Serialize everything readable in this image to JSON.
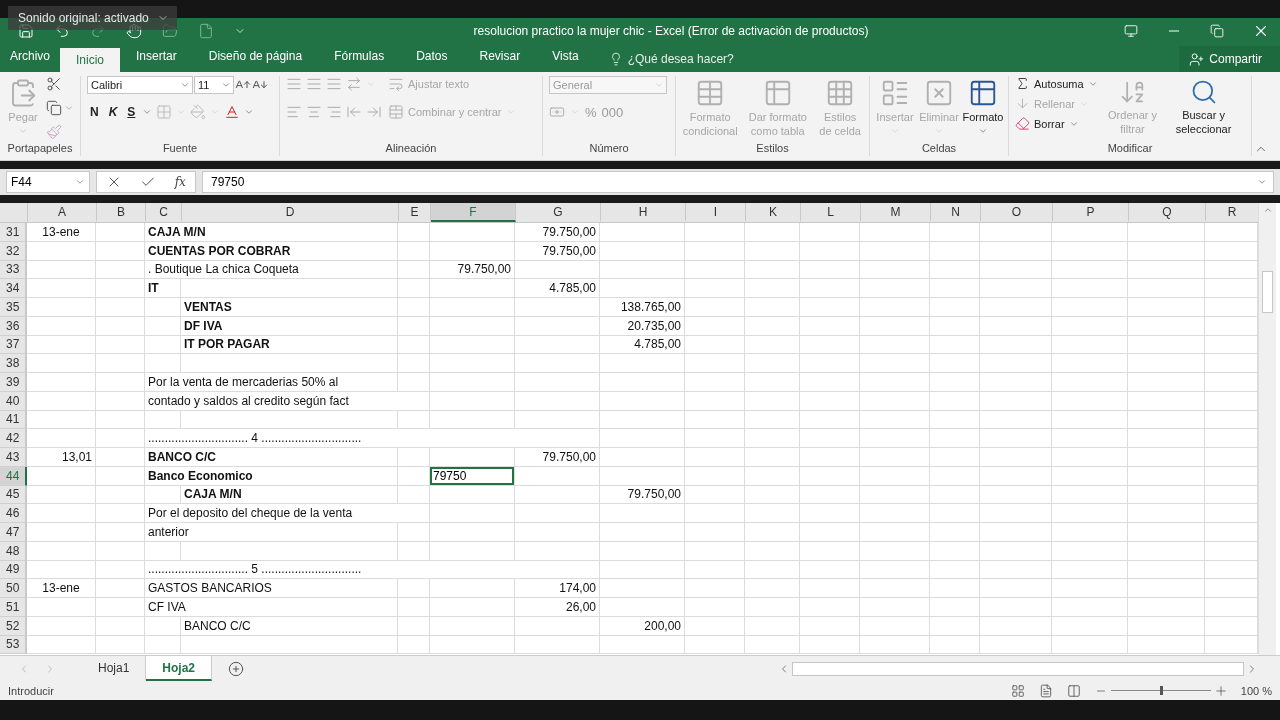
{
  "overlay": {
    "label": "Sonido original: activado"
  },
  "window": {
    "title": "resolucion practico la mujer chic - Excel (Error de activación de productos)"
  },
  "ribbon_tabs": [
    {
      "label": "Archivo",
      "selected": false
    },
    {
      "label": "Inicio",
      "selected": true
    },
    {
      "label": "Insertar",
      "selected": false
    },
    {
      "label": "Diseño de página",
      "selected": false
    },
    {
      "label": "Fórmulas",
      "selected": false
    },
    {
      "label": "Datos",
      "selected": false
    },
    {
      "label": "Revisar",
      "selected": false
    },
    {
      "label": "Vista",
      "selected": false
    }
  ],
  "tell_me": {
    "placeholder": "¿Qué desea hacer?"
  },
  "share_button": {
    "label": "Compartir"
  },
  "clipboard": {
    "title": "Portapapeles",
    "paste": {
      "label": "Pegar",
      "disabled": true
    }
  },
  "font": {
    "title": "Fuente",
    "name": "Calibri",
    "size": "11",
    "bold": "N",
    "italic": "K",
    "underline": "S"
  },
  "alignment": {
    "title": "Alineación",
    "wrap": {
      "label": "Ajustar texto",
      "disabled": true
    },
    "merge": {
      "label": "Combinar y centrar",
      "disabled": true
    }
  },
  "number": {
    "title": "Número",
    "format": {
      "value": "General",
      "disabled": true
    },
    "percent": "%",
    "thousands": "000"
  },
  "styles": {
    "title": "Estilos",
    "items": [
      {
        "label": "Formato condicional",
        "disabled": true
      },
      {
        "label": "Dar formato como tabla",
        "disabled": true
      },
      {
        "label": "Estilos de celda",
        "disabled": true
      }
    ]
  },
  "cells": {
    "title": "Celdas",
    "items": [
      {
        "label": "Insertar",
        "disabled": true
      },
      {
        "label": "Eliminar",
        "disabled": true
      },
      {
        "label": "Formato",
        "disabled": false
      }
    ]
  },
  "editing": {
    "title": "Modificar",
    "items": [
      {
        "label": "Autosuma",
        "disabled": false
      },
      {
        "label": "Rellenar",
        "disabled": true
      },
      {
        "label": "Borrar",
        "disabled": false
      }
    ],
    "sort": {
      "label": "Ordenar y filtrar",
      "disabled": true
    },
    "find": {
      "label": "Buscar y seleccionar",
      "disabled": false
    }
  },
  "formula_bar": {
    "name_box": "F44",
    "function_label": "fx",
    "value": "79750"
  },
  "sheet": {
    "columns": [
      {
        "label": "A",
        "selected": false
      },
      {
        "label": "B",
        "selected": false
      },
      {
        "label": "C",
        "selected": false
      },
      {
        "label": "D",
        "selected": false
      },
      {
        "label": "E",
        "selected": false
      },
      {
        "label": "F",
        "selected": true
      },
      {
        "label": "G",
        "selected": false
      },
      {
        "label": "H",
        "selected": false
      },
      {
        "label": "I",
        "selected": false
      },
      {
        "label": "K",
        "selected": false
      },
      {
        "label": "L",
        "selected": false
      },
      {
        "label": "M",
        "selected": false
      },
      {
        "label": "N",
        "selected": false
      },
      {
        "label": "O",
        "selected": false
      },
      {
        "label": "P",
        "selected": false
      },
      {
        "label": "Q",
        "selected": false
      },
      {
        "label": "R",
        "selected": false
      }
    ],
    "rows": [
      {
        "number": "31",
        "selected": false,
        "cells": {
          "a": {
            "text": "13-ene",
            "kind": "date"
          },
          "c": {
            "text": "CAJA M/N",
            "kind": "account"
          },
          "g": {
            "text": "79.750,00",
            "kind": "number"
          }
        }
      },
      {
        "number": "32",
        "selected": false,
        "cells": {
          "c": {
            "text": "CUENTAS POR COBRAR",
            "kind": "account"
          },
          "g": {
            "text": "79.750,00",
            "kind": "number"
          }
        }
      },
      {
        "number": "33",
        "selected": false,
        "cells": {
          "c": {
            "text": ". Boutique La chica Coqueta",
            "kind": "text"
          },
          "f": {
            "text": "79.750,00",
            "kind": "number"
          }
        }
      },
      {
        "number": "34",
        "selected": false,
        "cells": {
          "c": {
            "text": "IT",
            "kind": "account"
          },
          "g": {
            "text": "4.785,00",
            "kind": "number"
          }
        }
      },
      {
        "number": "35",
        "selected": false,
        "cells": {
          "d": {
            "text": "VENTAS",
            "kind": "account"
          },
          "h": {
            "text": "138.765,00",
            "kind": "number"
          }
        }
      },
      {
        "number": "36",
        "selected": false,
        "cells": {
          "d": {
            "text": "DF IVA",
            "kind": "account"
          },
          "h": {
            "text": "20.735,00",
            "kind": "number"
          }
        }
      },
      {
        "number": "37",
        "selected": false,
        "cells": {
          "d": {
            "text": "IT POR PAGAR",
            "kind": "account"
          },
          "h": {
            "text": "4.785,00",
            "kind": "number"
          }
        }
      },
      {
        "number": "38",
        "selected": false
      },
      {
        "number": "39",
        "selected": false,
        "cells": {
          "c": {
            "text": "Por la venta de mercaderias 50% al",
            "kind": "text"
          }
        }
      },
      {
        "number": "40",
        "selected": false,
        "cells": {
          "c": {
            "text": "contado y saldos al credito según fact",
            "kind": "text"
          }
        }
      },
      {
        "number": "41",
        "selected": false
      },
      {
        "number": "42",
        "selected": false,
        "cells": {
          "c": {
            "text": " .............................. 4 ..............................",
            "kind": "text"
          }
        }
      },
      {
        "number": "43",
        "selected": false,
        "cells": {
          "a": {
            "text": "13,01",
            "kind": "number"
          },
          "c": {
            "text": "BANCO C/C",
            "kind": "account"
          },
          "g": {
            "text": "79.750,00",
            "kind": "number"
          }
        }
      },
      {
        "number": "44",
        "selected": true,
        "cells": {
          "c": {
            "text": "Banco Economico",
            "kind": "account"
          },
          "f": {
            "text": "79750",
            "kind": "input"
          }
        }
      },
      {
        "number": "45",
        "selected": false,
        "cells": {
          "d": {
            "text": "CAJA M/N",
            "kind": "account"
          },
          "h": {
            "text": "79.750,00",
            "kind": "number"
          }
        }
      },
      {
        "number": "46",
        "selected": false,
        "cells": {
          "c": {
            "text": "Por el deposito del cheque de la venta",
            "kind": "text"
          }
        }
      },
      {
        "number": "47",
        "selected": false,
        "cells": {
          "c": {
            "text": "anterior",
            "kind": "text"
          }
        }
      },
      {
        "number": "48",
        "selected": false
      },
      {
        "number": "49",
        "selected": false,
        "cells": {
          "c": {
            "text": " .............................. 5 ..............................",
            "kind": "text"
          }
        }
      },
      {
        "number": "50",
        "selected": false,
        "cells": {
          "a": {
            "text": "13-ene",
            "kind": "date"
          },
          "c": {
            "text": "GASTOS BANCARIOS",
            "kind": "text"
          },
          "g": {
            "text": "174,00",
            "kind": "number"
          }
        }
      },
      {
        "number": "51",
        "selected": false,
        "cells": {
          "c": {
            "text": "CF IVA",
            "kind": "text"
          },
          "g": {
            "text": "26,00",
            "kind": "number"
          }
        }
      },
      {
        "number": "52",
        "selected": false,
        "cells": {
          "d": {
            "text": "BANCO C/C",
            "kind": "text"
          },
          "h": {
            "text": "200,00",
            "kind": "number"
          }
        }
      },
      {
        "number": "53",
        "selected": false
      }
    ]
  },
  "sheet_tabs": [
    {
      "label": "Hoja1",
      "selected": false
    },
    {
      "label": "Hoja2",
      "selected": true
    }
  ],
  "status_bar": {
    "mode": "Introducir",
    "zoom_slider": {
      "level": 0.5
    },
    "zoom": "100 %"
  }
}
